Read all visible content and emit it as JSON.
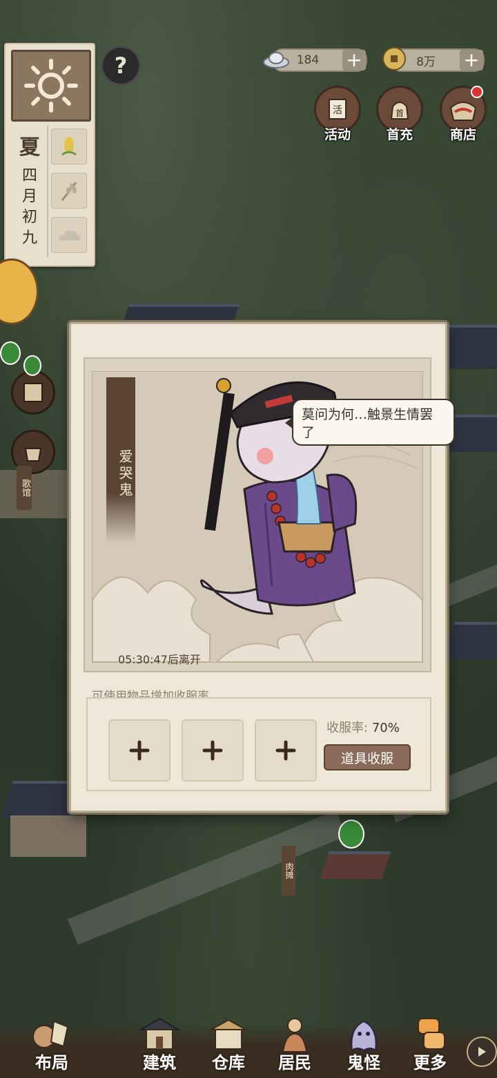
{
  "season_panel": {
    "season": "夏",
    "date_lines": [
      "四",
      "月",
      "初",
      "九"
    ]
  },
  "currency": {
    "silver": "184",
    "coins": "8万"
  },
  "top_buttons": [
    {
      "label": "活动",
      "icon": "activity-scroll-icon"
    },
    {
      "label": "首充",
      "icon": "first-recharge-bag-icon"
    },
    {
      "label": "商店",
      "icon": "shop-icon",
      "has_notification": true
    }
  ],
  "side": {
    "teahouse_label": "歌馆"
  },
  "map_labels": {
    "meat_stall": "肉摊"
  },
  "modal": {
    "ghost_name": "爱哭鬼",
    "speech": "莫问为何…触景生情罢了",
    "timer": "05:30:47",
    "timer_suffix": "后离开",
    "hint": "可使用物品增加收服率",
    "rate_label": "收服率:",
    "rate_value": "70%",
    "capture_button": "道具收服",
    "slot_count": 3
  },
  "bottom_nav": [
    {
      "label": "布局",
      "icon": "layout-icon"
    },
    {
      "label": "建筑",
      "icon": "building-icon"
    },
    {
      "label": "仓库",
      "icon": "warehouse-icon"
    },
    {
      "label": "居民",
      "icon": "residents-icon"
    },
    {
      "label": "鬼怪",
      "icon": "ghost-icon"
    },
    {
      "label": "更多",
      "icon": "more-icon"
    }
  ],
  "colors": {
    "panel_bg": "#efe7d8",
    "banner_brown": "#5a4535",
    "button_brown": "#8a6a58"
  }
}
